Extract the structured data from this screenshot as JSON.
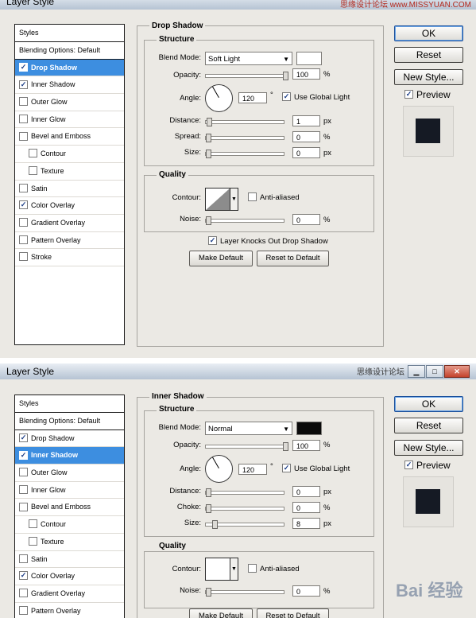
{
  "dialogs": [
    {
      "window_title": "Layer Style",
      "top_watermark": "思缘设计论坛  www.MISSYUAN.COM",
      "styles_header": "Styles",
      "blending_options": "Blending Options: Default",
      "style_items": [
        {
          "label": "Drop Shadow",
          "checked": true,
          "selected": true,
          "indent": false
        },
        {
          "label": "Inner Shadow",
          "checked": true,
          "selected": false,
          "indent": false
        },
        {
          "label": "Outer Glow",
          "checked": false,
          "selected": false,
          "indent": false
        },
        {
          "label": "Inner Glow",
          "checked": false,
          "selected": false,
          "indent": false
        },
        {
          "label": "Bevel and Emboss",
          "checked": false,
          "selected": false,
          "indent": false
        },
        {
          "label": "Contour",
          "checked": false,
          "selected": false,
          "indent": true
        },
        {
          "label": "Texture",
          "checked": false,
          "selected": false,
          "indent": true
        },
        {
          "label": "Satin",
          "checked": false,
          "selected": false,
          "indent": false
        },
        {
          "label": "Color Overlay",
          "checked": true,
          "selected": false,
          "indent": false
        },
        {
          "label": "Gradient Overlay",
          "checked": false,
          "selected": false,
          "indent": false
        },
        {
          "label": "Pattern Overlay",
          "checked": false,
          "selected": false,
          "indent": false
        },
        {
          "label": "Stroke",
          "checked": false,
          "selected": false,
          "indent": false
        }
      ],
      "section_title": "Drop Shadow",
      "structure_title": "Structure",
      "blend_mode_label": "Blend Mode:",
      "blend_mode_value": "Soft Light",
      "blend_color": "#ffffff",
      "opacity_label": "Opacity:",
      "opacity_value": "100",
      "angle_label": "Angle:",
      "angle_value": "120",
      "degree_symbol": "°",
      "use_global_light": "Use Global Light",
      "row3_label": "Distance:",
      "row3_value": "1",
      "row4_label": "Spread:",
      "row4_value": "0",
      "row5_label": "Size:",
      "row5_value": "0",
      "quality_title": "Quality",
      "contour_label": "Contour:",
      "anti_aliased": "Anti-aliased",
      "noise_label": "Noise:",
      "noise_value": "0",
      "knocks_out": "Layer Knocks Out Drop Shadow",
      "make_default": "Make Default",
      "reset_default": "Reset to Default",
      "ok": "OK",
      "reset": "Reset",
      "new_style": "New Style...",
      "preview": "Preview",
      "units": {
        "percent": "%",
        "px": "px"
      }
    },
    {
      "window_title": "Layer Style",
      "top_watermark": "思缘设计论坛",
      "styles_header": "Styles",
      "blending_options": "Blending Options: Default",
      "style_items": [
        {
          "label": "Drop Shadow",
          "checked": true,
          "selected": false,
          "indent": false
        },
        {
          "label": "Inner Shadow",
          "checked": true,
          "selected": true,
          "indent": false
        },
        {
          "label": "Outer Glow",
          "checked": false,
          "selected": false,
          "indent": false
        },
        {
          "label": "Inner Glow",
          "checked": false,
          "selected": false,
          "indent": false
        },
        {
          "label": "Bevel and Emboss",
          "checked": false,
          "selected": false,
          "indent": false
        },
        {
          "label": "Contour",
          "checked": false,
          "selected": false,
          "indent": true
        },
        {
          "label": "Texture",
          "checked": false,
          "selected": false,
          "indent": true
        },
        {
          "label": "Satin",
          "checked": false,
          "selected": false,
          "indent": false
        },
        {
          "label": "Color Overlay",
          "checked": true,
          "selected": false,
          "indent": false
        },
        {
          "label": "Gradient Overlay",
          "checked": false,
          "selected": false,
          "indent": false
        },
        {
          "label": "Pattern Overlay",
          "checked": false,
          "selected": false,
          "indent": false
        }
      ],
      "section_title": "Inner Shadow",
      "structure_title": "Structure",
      "blend_mode_label": "Blend Mode:",
      "blend_mode_value": "Normal",
      "blend_color": "#0a0a0a",
      "opacity_label": "Opacity:",
      "opacity_value": "100",
      "angle_label": "Angle:",
      "angle_value": "120",
      "degree_symbol": "°",
      "use_global_light": "Use Global Light",
      "row3_label": "Distance:",
      "row3_value": "0",
      "row4_label": "Choke:",
      "row4_value": "0",
      "row5_label": "Size:",
      "row5_value": "8",
      "quality_title": "Quality",
      "contour_label": "Contour:",
      "anti_aliased": "Anti-aliased",
      "noise_label": "Noise:",
      "noise_value": "0",
      "make_default": "Make Default",
      "reset_default": "Reset to Default",
      "ok": "OK",
      "reset": "Reset",
      "new_style": "New Style...",
      "preview": "Preview",
      "units": {
        "percent": "%",
        "px": "px"
      }
    }
  ],
  "bottom_watermark": "Bai 经验"
}
